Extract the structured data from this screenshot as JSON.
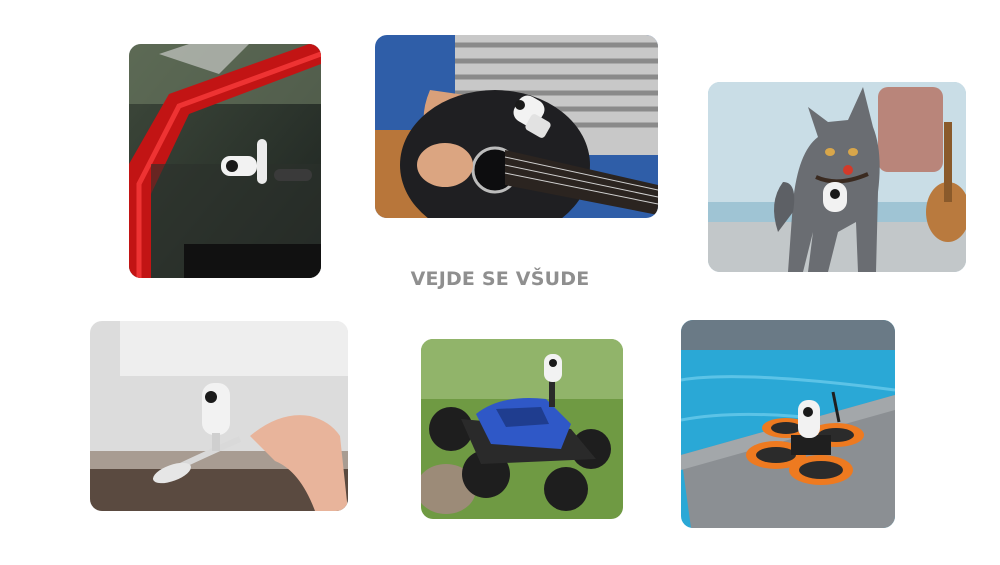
{
  "headline": "VEJDE SE VŠUDE",
  "colors": {
    "background": "#ffffff",
    "headline": "#8f8f8f",
    "camera_body": "#f2f2f2",
    "camera_lens": "#1a1a1a"
  },
  "photos": [
    {
      "subject": "camera-on-red-vehicle-door"
    },
    {
      "subject": "camera-on-guitar"
    },
    {
      "subject": "camera-on-cat-collar"
    },
    {
      "subject": "camera-on-spoon"
    },
    {
      "subject": "camera-on-rc-crawler"
    },
    {
      "subject": "camera-on-fpv-drone"
    }
  ]
}
